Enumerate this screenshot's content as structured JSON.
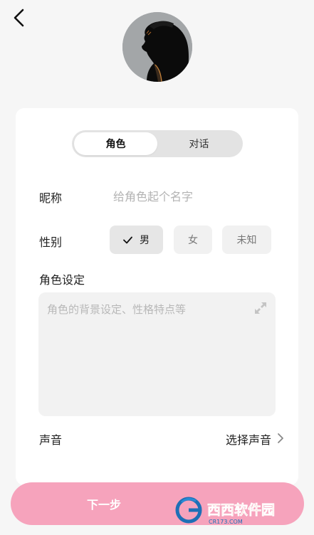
{
  "tabs": [
    "角色",
    "对话"
  ],
  "nickname": {
    "label": "昵称",
    "value": "",
    "placeholder": "给角色起个名字"
  },
  "gender": {
    "label": "性别",
    "options": [
      "男",
      "女",
      "未知"
    ],
    "selected": "男"
  },
  "role_setting": {
    "label": "角色设定",
    "value": "",
    "placeholder": "角色的背景设定、性格特点等"
  },
  "voice": {
    "label": "声音",
    "select_label": "选择声音"
  },
  "next_button": "下一步",
  "watermark": {
    "brand": "西西软件园",
    "domain": "CR173.COM"
  },
  "colors": {
    "accent": "#f6a3bc",
    "card": "#ffffff",
    "background": "#f6f6f6"
  }
}
